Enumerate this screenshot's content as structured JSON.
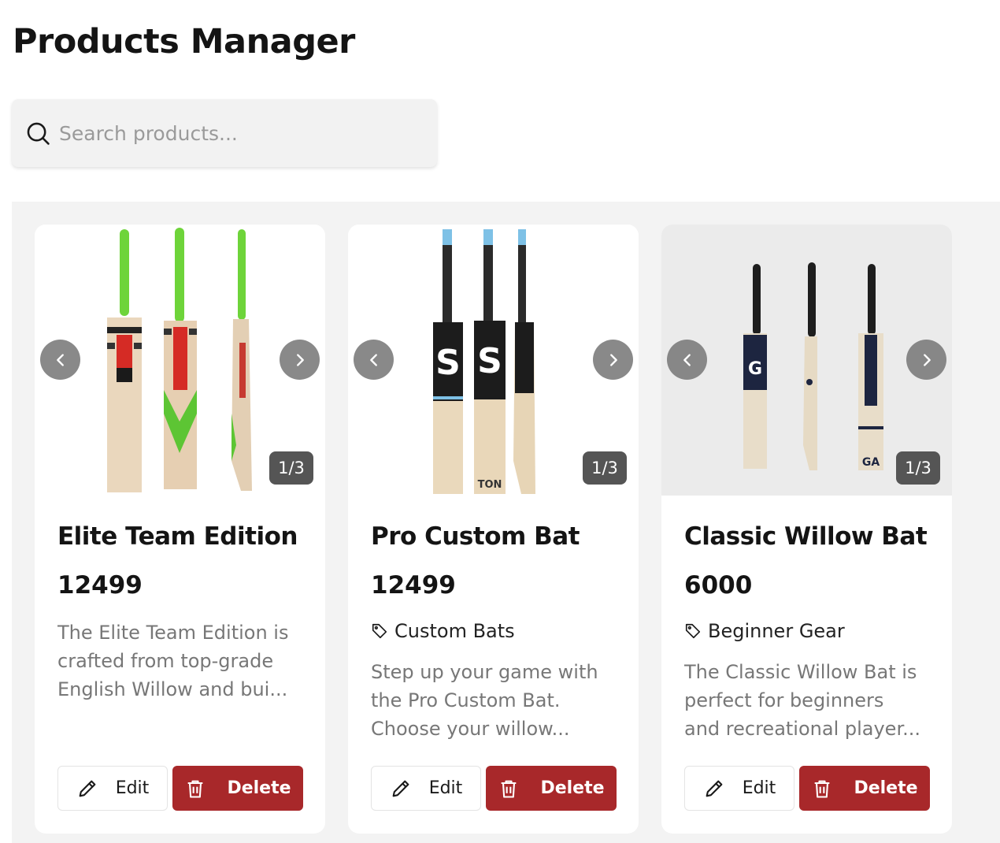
{
  "page": {
    "title": "Products Manager"
  },
  "search": {
    "placeholder": "Search products..."
  },
  "colors": {
    "delete_button": "#a8282a",
    "card_background": "#ffffff",
    "grid_background": "#f3f3f3"
  },
  "products": [
    {
      "name": "Elite Team Edition",
      "price": "12499",
      "category": "",
      "image_counter": "1/3",
      "description_lines": [
        "The Elite Team Edition is",
        "crafted from top-grade",
        "English Willow and bui..."
      ],
      "edit_label": "Edit",
      "delete_label": "Delete",
      "image_icon": "green-grip-cricket-bats"
    },
    {
      "name": "Pro Custom Bat",
      "price": "12499",
      "category": "Custom Bats",
      "image_counter": "1/3",
      "description_lines": [
        "Step up your game with",
        "the Pro Custom Bat.",
        "Choose your willow..."
      ],
      "edit_label": "Edit",
      "delete_label": "Delete",
      "image_icon": "blue-grip-cricket-bats"
    },
    {
      "name": "Classic Willow Bat",
      "price": "6000",
      "category": "Beginner Gear",
      "image_counter": "1/3",
      "description_lines": [
        "The Classic Willow Bat is",
        "perfect for beginners",
        "and recreational player..."
      ],
      "edit_label": "Edit",
      "delete_label": "Delete",
      "image_icon": "black-grip-cricket-bats"
    }
  ]
}
